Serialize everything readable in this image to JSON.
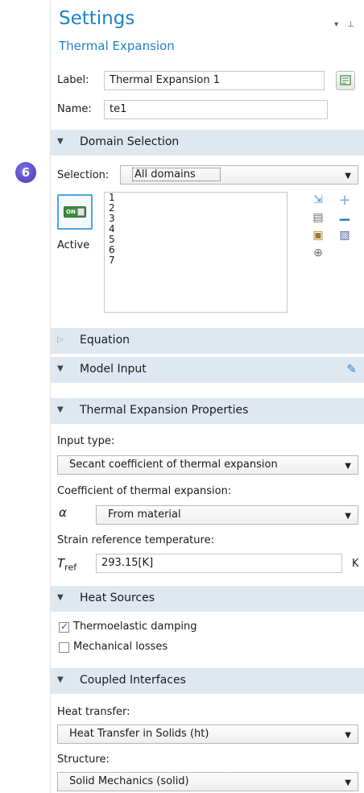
{
  "step_badge": "6",
  "header": {
    "title": "Settings",
    "subtitle": "Thermal Expansion"
  },
  "label_field": {
    "label": "Label:",
    "value": "Thermal Expansion 1"
  },
  "name_field": {
    "label": "Name:",
    "value": "te1"
  },
  "domain_selection": {
    "title": "Domain Selection",
    "selection_label": "Selection:",
    "selection_value": "All domains",
    "active_label": "Active",
    "toggle_text": "ON",
    "domains": [
      "1",
      "2",
      "3",
      "4",
      "5",
      "6",
      "7"
    ]
  },
  "equation": {
    "title": "Equation"
  },
  "model_input": {
    "title": "Model Input"
  },
  "thermal_props": {
    "title": "Thermal Expansion Properties",
    "input_type_label": "Input type:",
    "input_type_value": "Secant coefficient of thermal expansion",
    "coeff_label": "Coefficient of thermal expansion:",
    "alpha_symbol": "α",
    "coeff_value": "From material",
    "strain_label": "Strain reference temperature:",
    "tref_symbol": "T",
    "tref_sub": "ref",
    "tref_value": "293.15[K]",
    "tref_unit": "K"
  },
  "heat_sources": {
    "title": "Heat Sources",
    "thermoelastic_label": "Thermoelastic damping",
    "thermoelastic_checked": true,
    "mechanical_label": "Mechanical losses",
    "mechanical_checked": false
  },
  "coupled": {
    "title": "Coupled Interfaces",
    "heat_label": "Heat transfer:",
    "heat_value": "Heat Transfer in Solids (ht)",
    "structure_label": "Structure:",
    "structure_value": "Solid Mechanics (solid)"
  },
  "colors": {
    "accent": "#1e83c6",
    "section_bg": "#dfe8f1"
  }
}
